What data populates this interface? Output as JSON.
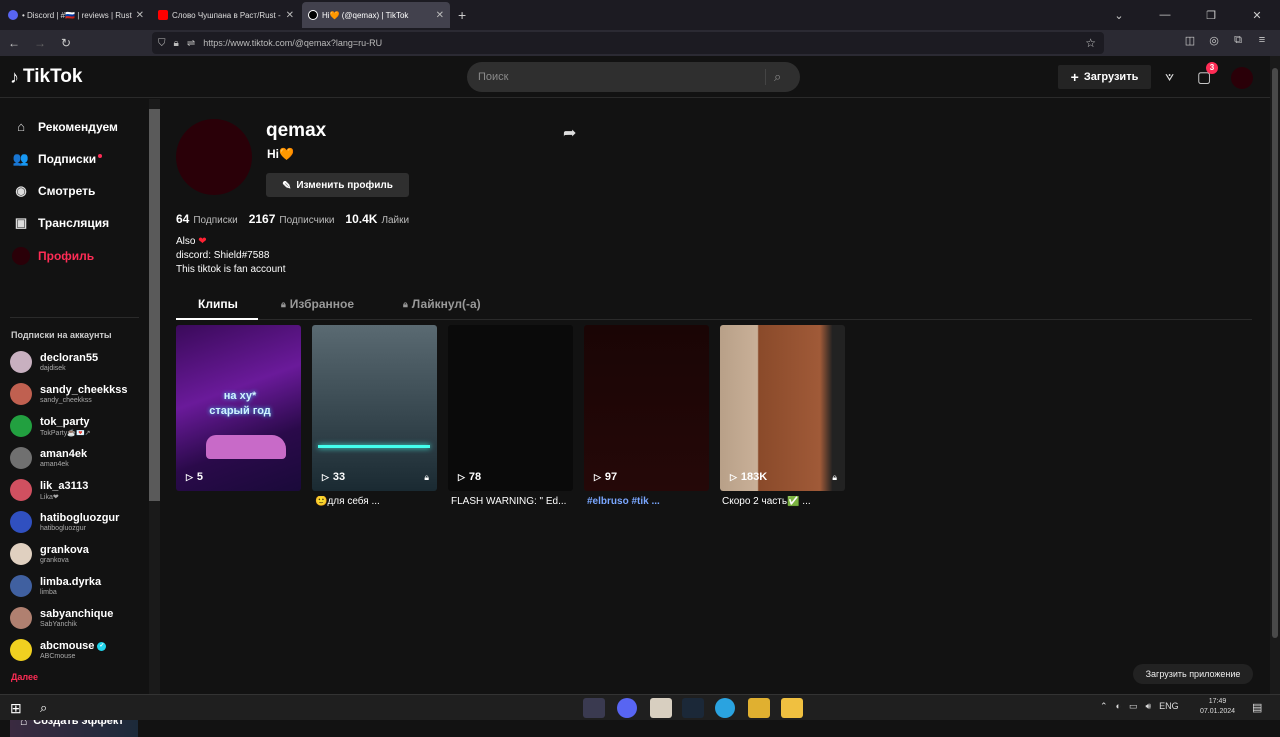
{
  "browser": {
    "tabs": [
      {
        "title": "• Discord | #🇷🇺 | reviews | Rust🇷🇺",
        "color": "#5865f2",
        "close": "✕"
      },
      {
        "title": "Слово Чушпана в Раст/Rust - ",
        "color": "#ff0000",
        "close": "✕"
      },
      {
        "title": "Hi🧡 (@qemax) | TikTok",
        "color": "#000000",
        "close": "✕"
      }
    ],
    "new_tab": "+",
    "url": "https://www.tiktok.com/@qemax?lang=ru-RU",
    "window_controls": [
      "⌄",
      "—",
      "❐",
      "✕"
    ]
  },
  "header": {
    "logo_text": "TikTok",
    "search_placeholder": "Поиск",
    "upload_label": "Загрузить",
    "inbox_badge": "3"
  },
  "sidebar": {
    "nav": [
      {
        "label": "Рекомендуем",
        "icon": "⌂"
      },
      {
        "label": "Подписки",
        "icon": "👥"
      },
      {
        "label": "Смотреть",
        "icon": "◉"
      },
      {
        "label": "Трансляция",
        "icon": "▣"
      },
      {
        "label": "Профиль",
        "icon": ""
      }
    ],
    "following_heading": "Подписки на аккаунты",
    "accounts": [
      {
        "name": "decloran55",
        "username": "dajdisek",
        "color": "#c8b0c0"
      },
      {
        "name": "sandy_cheekkss",
        "username": "sandy_cheekkss",
        "color": "#c06050"
      },
      {
        "name": "tok_party",
        "username": "TokParty☕💌↗",
        "color": "#22a040"
      },
      {
        "name": "aman4ek",
        "username": "aman4ek",
        "color": "#707070"
      },
      {
        "name": "lik_a3113",
        "username": "Lika❤",
        "color": "#d05060"
      },
      {
        "name": "hatibogluozgur",
        "username": "hatibogluozgur",
        "color": "#3050c0"
      },
      {
        "name": "grankova",
        "username": "grankova",
        "color": "#e0d0c0"
      },
      {
        "name": "limba.dyrka",
        "username": "limba",
        "color": "#4060a0"
      },
      {
        "name": "sabyanchique",
        "username": "SabYanchik",
        "color": "#b08070"
      },
      {
        "name": "abcmouse",
        "username": "ABCmouse",
        "color": "#f0d020",
        "verified": true
      }
    ],
    "more_label": "Далее",
    "create_effect_label": "Создать эффект"
  },
  "profile": {
    "username": "qemax",
    "nickname": "Hi",
    "nickname_heart": "🧡",
    "edit_label": "Изменить профиль",
    "stats": [
      {
        "value": "64",
        "label": "Подписки"
      },
      {
        "value": "2167",
        "label": "Подписчики"
      },
      {
        "value": "10.4K",
        "label": "Лайки"
      }
    ],
    "bio_line1": "Also",
    "bio_heart": "❤",
    "bio_line2": "discord: Shield#7588",
    "bio_line3": "This tiktok is fan account",
    "tabs": [
      "Клипы",
      "Избранное",
      "Лайкнул(-а)"
    ],
    "videos": [
      {
        "views": "5",
        "caption": "",
        "overlay": "на ху*\nстарый год",
        "locked": false
      },
      {
        "views": "33",
        "caption": "🙂для себя ...",
        "locked": true
      },
      {
        "views": "78",
        "caption": "FLASH WARNING: \" Ed...",
        "locked": false
      },
      {
        "views": "97",
        "caption": "#elbruso #tik ...",
        "locked": false
      },
      {
        "views": "183K",
        "caption": "Скоро 2 часть✅ ...",
        "locked": true
      }
    ],
    "video1_overlay_l1": "на ху*",
    "video1_overlay_l2": "старый год"
  },
  "download_app_label": "Загрузить приложение",
  "taskbar": {
    "lang": "ENG",
    "time": "17:49",
    "date": "07.01.2024"
  }
}
